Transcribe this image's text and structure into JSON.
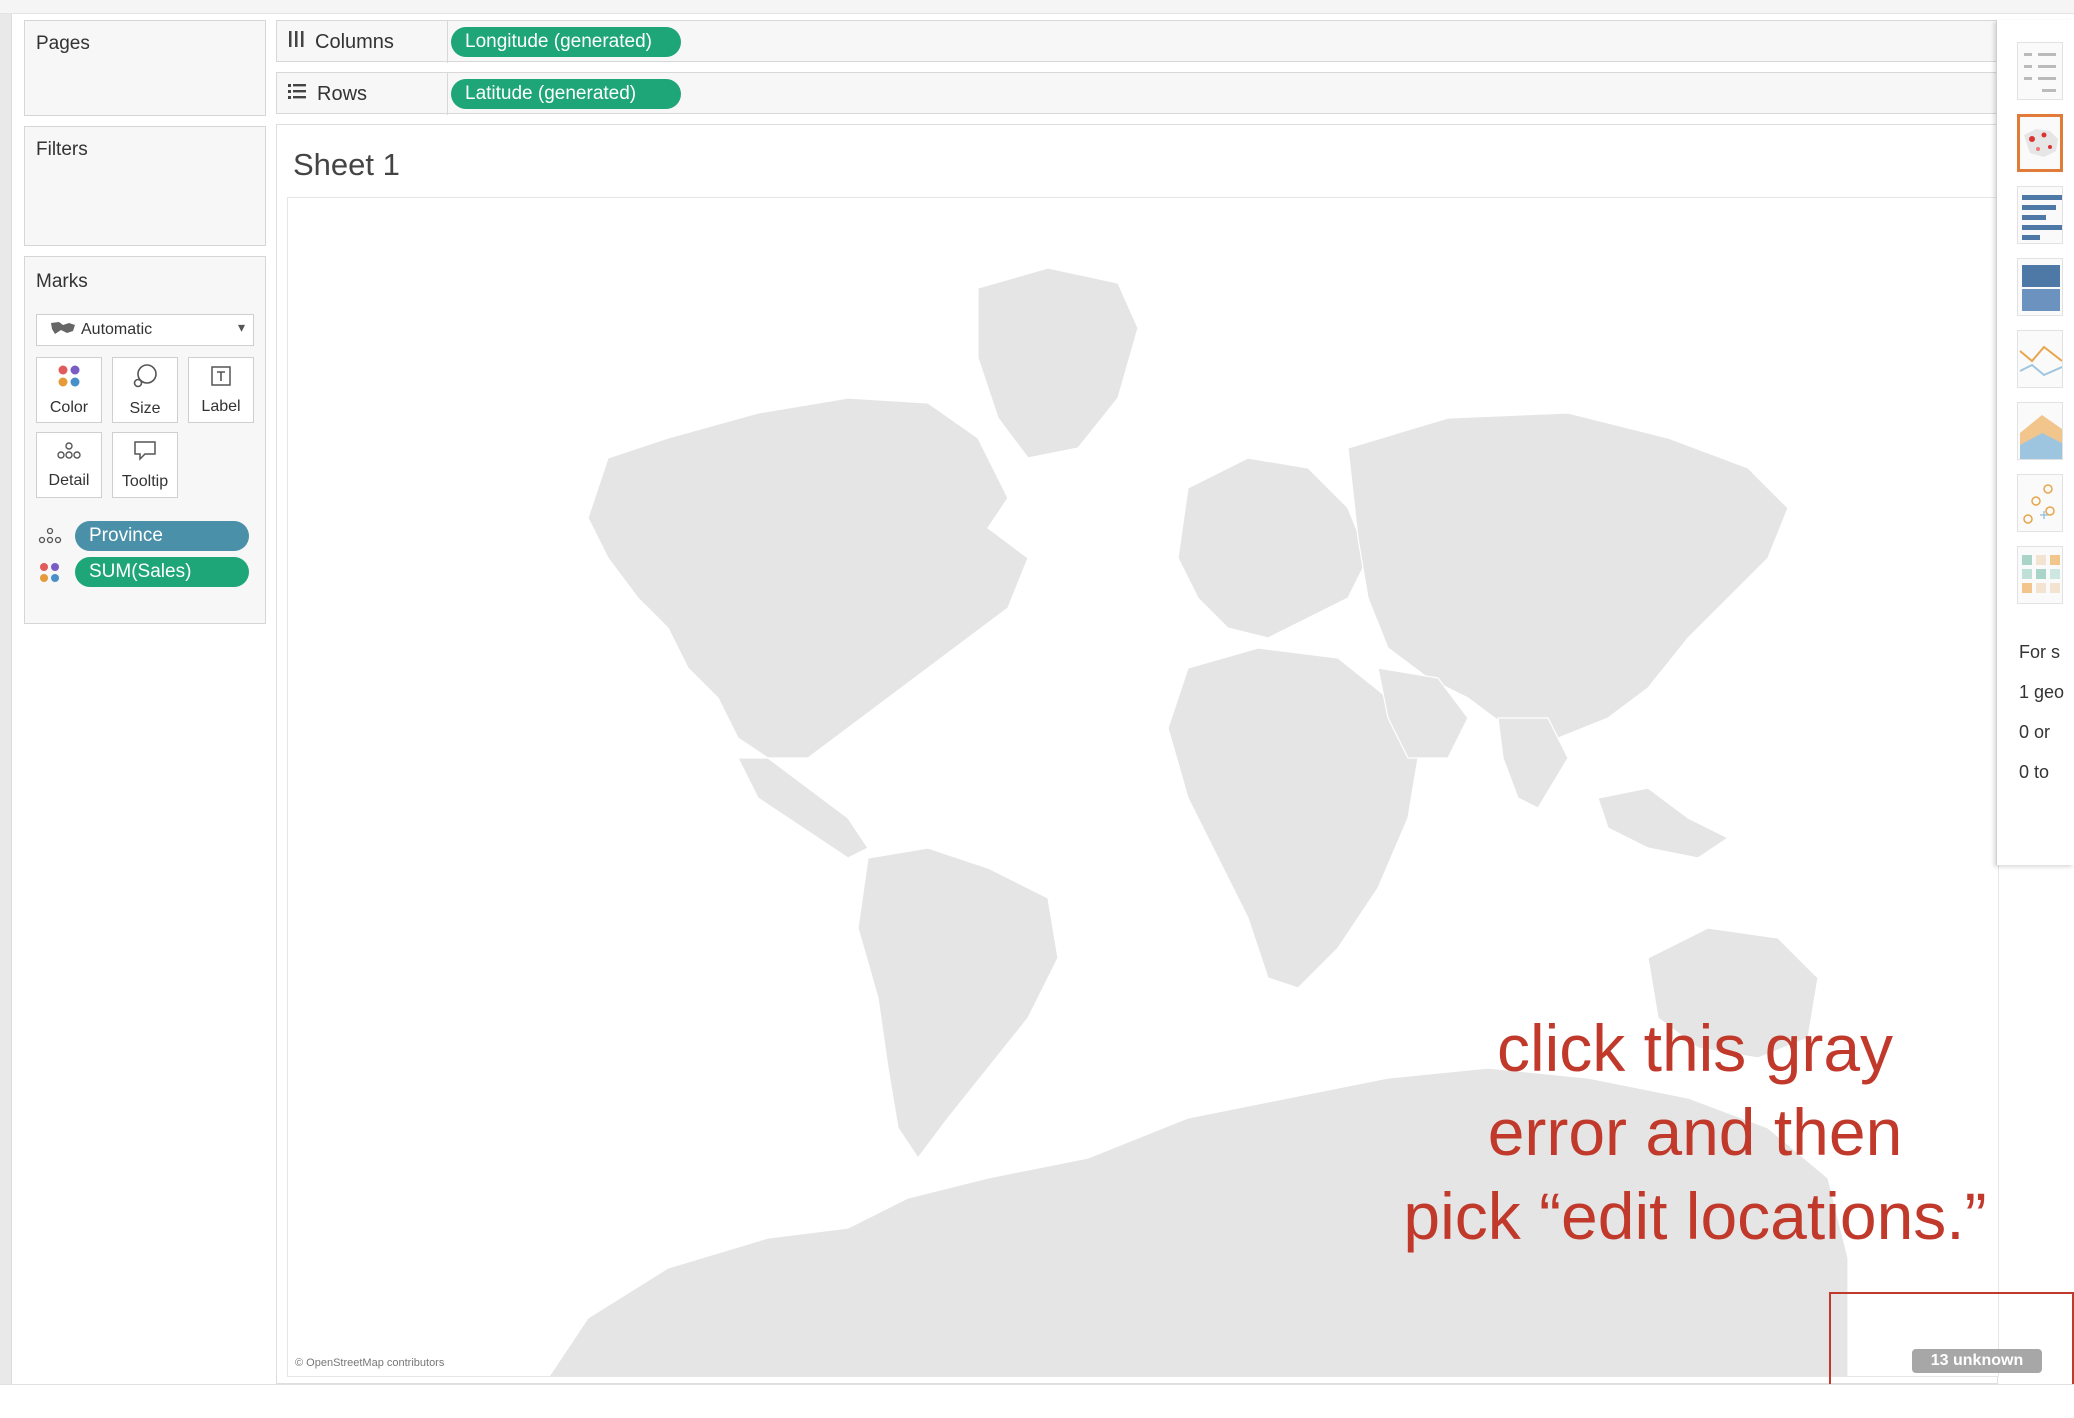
{
  "shelves": {
    "pages_title": "Pages",
    "filters_title": "Filters",
    "columns": {
      "label": "Columns",
      "pill": "Longitude (generated)"
    },
    "rows": {
      "label": "Rows",
      "pill": "Latitude (generated)"
    }
  },
  "marks": {
    "title": "Marks",
    "mark_type": "Automatic",
    "buttons": {
      "color": "Color",
      "size": "Size",
      "label": "Label",
      "detail": "Detail",
      "tooltip": "Tooltip"
    },
    "fields": [
      {
        "name": "Province",
        "color": "#4a90a8",
        "role": "detail"
      },
      {
        "name": "SUM(Sales)",
        "color": "#1ea578",
        "role": "color"
      }
    ]
  },
  "view": {
    "sheet_title": "Sheet 1",
    "attribution": "© OpenStreetMap contributors",
    "unknown_indicator": "13 unknown",
    "land_color": "#e5e5e5"
  },
  "annotation": {
    "line1": "click this gray",
    "line2": "error and then",
    "line3": "pick “edit locations.”",
    "color": "#c0392b"
  },
  "show_me": {
    "chart_thumbnails": [
      "text-table",
      "symbol-map",
      "horizontal-bars",
      "stacked-bars",
      "lines",
      "area",
      "scatter",
      "heat-map"
    ],
    "selected": "symbol-map",
    "hints": [
      "For s",
      "1 geo",
      "0 or",
      "0 to"
    ]
  }
}
